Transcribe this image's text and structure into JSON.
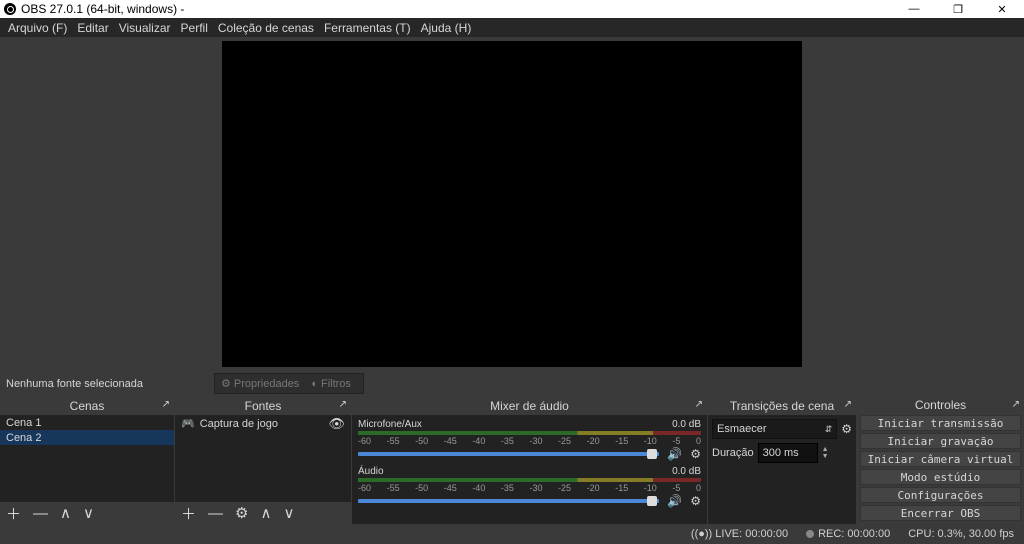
{
  "titlebar": {
    "title": "OBS 27.0.1 (64-bit, windows) -"
  },
  "menu": {
    "file": "Arquivo (F)",
    "edit": "Editar",
    "view": "Visualizar",
    "profile": "Perfil",
    "scene_collection": "Coleção de cenas",
    "tools": "Ferramentas (T)",
    "help": "Ajuda (H)"
  },
  "no_source_selected": "Nenhuma fonte selecionada",
  "props": {
    "properties": "Propriedades",
    "filters": "Filtros"
  },
  "docks": {
    "scenes_title": "Cenas",
    "sources_title": "Fontes",
    "audio_title": "Mixer de áudio",
    "transitions_title": "Transições de cena",
    "controls_title": "Controles"
  },
  "scenes": {
    "items": [
      {
        "label": "Cena 1"
      },
      {
        "label": "Cena 2"
      }
    ]
  },
  "sources": {
    "items": [
      {
        "label": "Captura de jogo"
      }
    ]
  },
  "audio": {
    "mic": {
      "name": "Microfone/Aux",
      "db": "0.0 dB"
    },
    "desktop": {
      "name": "Áudio",
      "db": "0.0 dB"
    },
    "ticks": [
      "-60",
      "-55",
      "-50",
      "-45",
      "-40",
      "-35",
      "-30",
      "-25",
      "-20",
      "-15",
      "-10",
      "-5",
      "0"
    ]
  },
  "transitions": {
    "select": "Esmaecer",
    "duration_label": "Duração",
    "duration_value": "300 ms"
  },
  "controls": {
    "start_stream": "Iniciar transmissão",
    "start_rec": "Iniciar gravação",
    "start_vcam": "Iniciar câmera virtual",
    "studio": "Modo estúdio",
    "settings": "Configurações",
    "exit": "Encerrar OBS"
  },
  "status": {
    "live": "LIVE: 00:00:00",
    "rec": "REC: 00:00:00",
    "cpu": "CPU: 0.3%, 30.00 fps"
  }
}
